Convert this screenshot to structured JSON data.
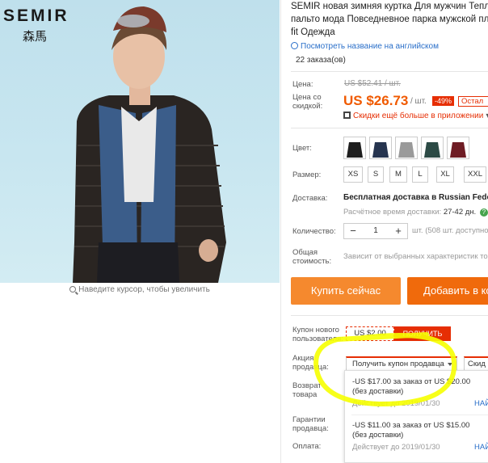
{
  "brand": {
    "name": "SEMIR",
    "chinese": "森馬"
  },
  "zoom_hint": "Наведите курсор, чтобы увеличить",
  "product": {
    "title_lines": [
      "SEMIR новая зимняя куртка Для мужчин Тепл",
      "пальто мода Повседневное парка мужской пл",
      "fit Одежда"
    ],
    "translate_link": "Посмотреть название на английском",
    "orders": "22 заказа(ов)"
  },
  "price": {
    "label": "Цена:",
    "old": "US $52.41 / шт.",
    "discount_label": "Цена со скидкой:",
    "current": "US $26.73",
    "unit": "/ шт.",
    "discount_badge": "-49%",
    "remaining": "Остал",
    "app_discount": "Скидки ещё больше в приложении"
  },
  "options": {
    "color_label": "Цвет:",
    "colors": [
      {
        "name": "black",
        "hex": "#1e1e1e"
      },
      {
        "name": "navy",
        "hex": "#26344f"
      },
      {
        "name": "grey",
        "hex": "#9a9a9a"
      },
      {
        "name": "dark-green",
        "hex": "#2c4a45"
      },
      {
        "name": "wine",
        "hex": "#6e1c24"
      }
    ],
    "size_label": "Размер:",
    "sizes": [
      "XS",
      "S",
      "M",
      "L",
      "XL",
      "XXL"
    ]
  },
  "delivery": {
    "label": "Доставка:",
    "value": "Бесплатная доставка в Russian Federat",
    "time_label": "Расчётное время доставки:",
    "time_value": "27-42 дн.",
    "help_icon": "?"
  },
  "quantity": {
    "label": "Количество:",
    "minus": "−",
    "value": "1",
    "plus": "+",
    "stock": "шт. (508 шт. доступно)"
  },
  "total": {
    "label": "Общая стоимость:",
    "value": "Зависит от выбранных характеристик тов"
  },
  "buttons": {
    "buy_now": "Купить сейчас",
    "add_to_cart": "Добавить в кор"
  },
  "new_user_coupon": {
    "label": "Купон нового пользователя:",
    "value": "US $2.00",
    "get": "ПОЛУЧИТЬ"
  },
  "seller_promo": {
    "label": "Акция продавца:",
    "dropdown": "Получить купон продавца",
    "extra": "Скид"
  },
  "return_label": "Возврат товара",
  "guarantee_label": "Гарантии продавца:",
  "payment_label": "Оплата:",
  "coupons": [
    {
      "text_line1": "-US $17.00 за заказ от US $20.00",
      "text_line2": "(без доставки)",
      "valid": "Действует до 2019/01/30",
      "get": "НАЙ"
    },
    {
      "text_line1": "-US $11.00 за заказ от US $15.00",
      "text_line2": "(без доставки)",
      "valid": "Действует до 2019/01/30",
      "get": "НАЙ"
    }
  ],
  "colors": {
    "accent": "#f05a00",
    "red": "#e62e04",
    "buy": "#f5892e",
    "cart": "#f06a0c",
    "link": "#2a6fc9",
    "highlight": "#f6ff00"
  }
}
